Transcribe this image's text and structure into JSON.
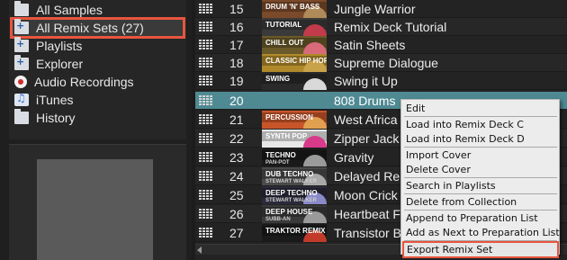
{
  "browser": {
    "items": [
      {
        "label": "All Samples",
        "icon": "folder-icon"
      },
      {
        "label": "All Remix Sets (27)",
        "icon": "folder-plus-icon",
        "highlighted": true
      },
      {
        "label": "Playlists",
        "icon": "playlists-icon"
      },
      {
        "label": "Explorer",
        "icon": "explorer-icon"
      },
      {
        "label": "Audio Recordings",
        "icon": "record-icon"
      },
      {
        "label": "iTunes",
        "icon": "itunes-icon"
      },
      {
        "label": "History",
        "icon": "history-icon"
      }
    ]
  },
  "tracks": [
    {
      "num": "15",
      "cover": "DRUM 'N' BASS",
      "cover_sub": "",
      "title": "Jungle Warrior",
      "colors": [
        "#7a4a2a",
        "#b08a58"
      ]
    },
    {
      "num": "16",
      "cover": "TUTORIAL",
      "cover_sub": "",
      "title": "Remix Deck Tutorial",
      "colors": [
        "#3a3a3a",
        "#c23b4a"
      ]
    },
    {
      "num": "17",
      "cover": "CHILL OUT",
      "cover_sub": "",
      "title": "Satin Sheets",
      "colors": [
        "#6a5a2a",
        "#d86a7a"
      ]
    },
    {
      "num": "18",
      "cover": "CLASSIC HIP HOP",
      "cover_sub": "",
      "title": "Supreme Dialogue",
      "colors": [
        "#b08a2a",
        "#c9a24a"
      ]
    },
    {
      "num": "19",
      "cover": "SWING",
      "cover_sub": "",
      "title": "Swing it Up",
      "colors": [
        "#2a2a2a",
        "#d8d8d8"
      ]
    },
    {
      "num": "20",
      "cover": "",
      "cover_sub": "",
      "title": "808 Drums",
      "colors": [
        "#4f8a93",
        "#4f8a93"
      ],
      "selected": true
    },
    {
      "num": "21",
      "cover": "PERCUSSION",
      "cover_sub": "",
      "title": "West Africa",
      "colors": [
        "#c8552a",
        "#e0a050"
      ]
    },
    {
      "num": "22",
      "cover": "SYNTH POP",
      "cover_sub": "",
      "title": "Zipper Jack",
      "colors": [
        "#e8e8e8",
        "#d83a8a"
      ]
    },
    {
      "num": "23",
      "cover": "TECHNO",
      "cover_sub": "PAN-POT",
      "title": "Gravity",
      "colors": [
        "#1a1a1a",
        "#9a9a9a"
      ]
    },
    {
      "num": "24",
      "cover": "DUB TECHNO",
      "cover_sub": "STEWART WALKER",
      "title": "Delayed Re",
      "colors": [
        "#4a4a4a",
        "#a8a8a8"
      ]
    },
    {
      "num": "25",
      "cover": "DEEP TECHNO",
      "cover_sub": "STEWART WALKER",
      "title": "Moon Crick",
      "colors": [
        "#2a2a3a",
        "#8a8ac8"
      ]
    },
    {
      "num": "26",
      "cover": "DEEP HOUSE",
      "cover_sub": "SUBB-AN",
      "title": "Heartbeat F",
      "colors": [
        "#3a3a3a",
        "#9a9a9a"
      ]
    },
    {
      "num": "27",
      "cover": "TRAKTOR REMIX SET",
      "cover_sub": "",
      "title": "Transistor B",
      "colors": [
        "#1a1a1a",
        "#c23b2a"
      ]
    }
  ],
  "context_menu": {
    "groups": [
      [
        "Edit"
      ],
      [
        "Load into Remix Deck C",
        "Load into Remix Deck D"
      ],
      [
        "Import Cover",
        "Delete Cover"
      ],
      [
        "Search in Playlists"
      ],
      [
        "Delete from Collection"
      ],
      [
        "Append to Preparation List",
        "Add as Next to Preparation List"
      ],
      [
        "Export Remix Set"
      ]
    ],
    "highlighted": "Export Remix Set"
  },
  "colors": {
    "highlight": "#e8553f",
    "selected_row": "#4f8a93"
  }
}
